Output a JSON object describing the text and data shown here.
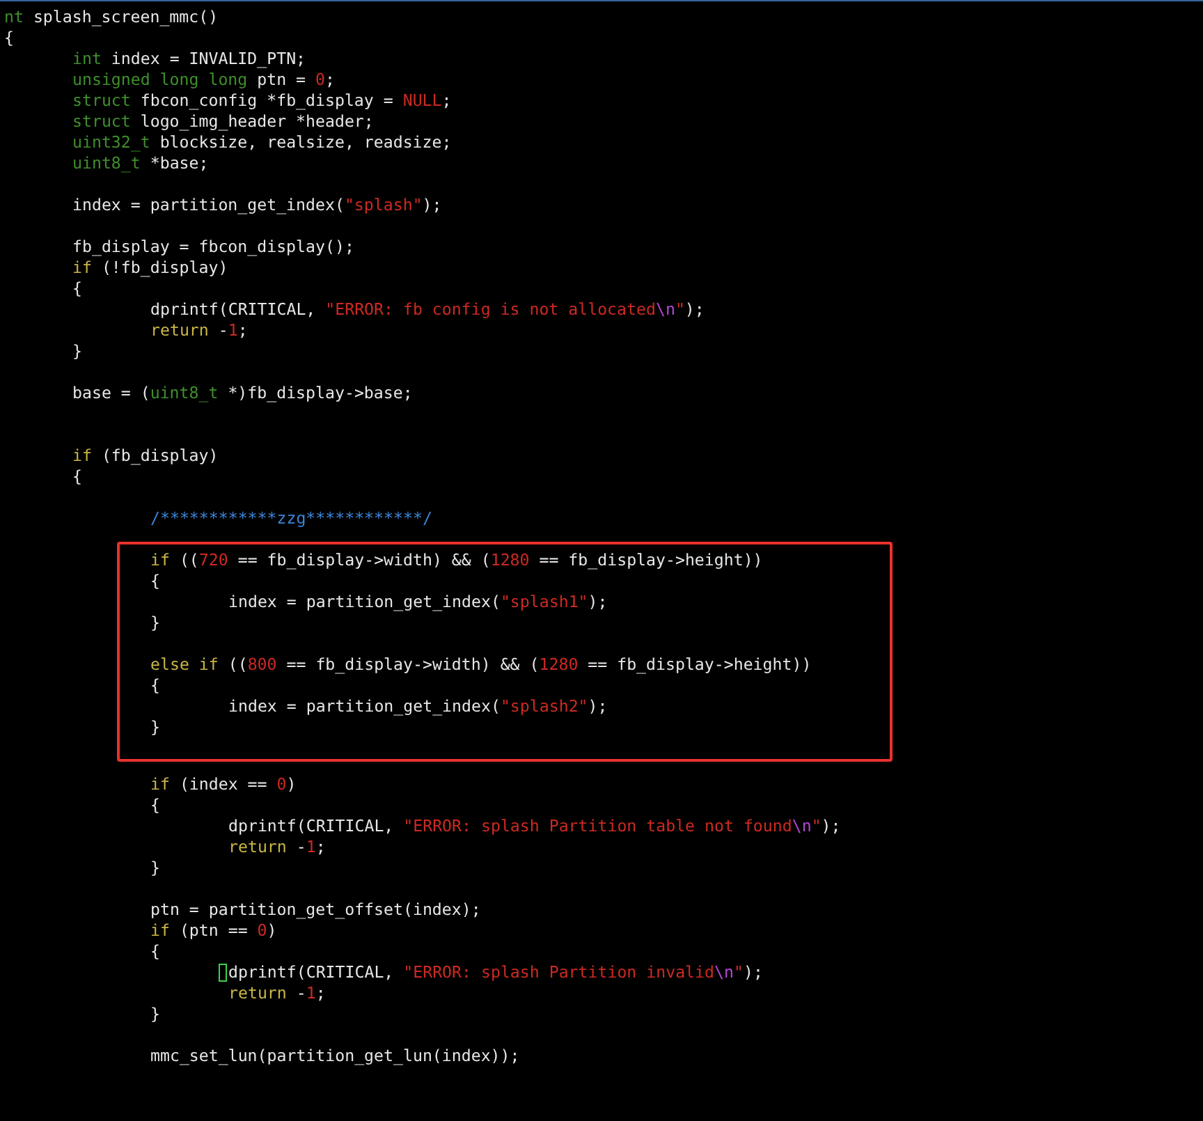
{
  "editor": {
    "lines": [
      {
        "kind": "code",
        "segments": [
          {
            "text": "nt",
            "kind": "type"
          },
          {
            "text": " splash_screen_mmc()",
            "kind": "plain"
          }
        ]
      },
      {
        "kind": "code",
        "segments": [
          {
            "text": "{",
            "kind": "plain"
          }
        ],
        "children": [
          {
            "kind": "code",
            "segments": [
              {
                "text": "int",
                "kind": "type"
              },
              {
                "text": " index = INVALID_PTN;",
                "kind": "plain"
              }
            ]
          },
          {
            "kind": "code",
            "segments": [
              {
                "text": "unsigned long long",
                "kind": "type"
              },
              {
                "text": " ptn = ",
                "kind": "plain"
              },
              {
                "text": "0",
                "kind": "number"
              },
              {
                "text": ";",
                "kind": "plain"
              }
            ]
          },
          {
            "kind": "code",
            "segments": [
              {
                "text": "struct",
                "kind": "type"
              },
              {
                "text": " fbcon_config *fb_display = ",
                "kind": "plain"
              },
              {
                "text": "NULL",
                "kind": "number"
              },
              {
                "text": ";",
                "kind": "plain"
              }
            ]
          },
          {
            "kind": "code",
            "segments": [
              {
                "text": "struct",
                "kind": "type"
              },
              {
                "text": " logo_img_header *header;",
                "kind": "plain"
              }
            ]
          },
          {
            "kind": "code",
            "segments": [
              {
                "text": "uint32_t",
                "kind": "type"
              },
              {
                "text": " blocksize, realsize, readsize;",
                "kind": "plain"
              }
            ]
          },
          {
            "kind": "code",
            "segments": [
              {
                "text": "uint8_t",
                "kind": "type"
              },
              {
                "text": " *base;",
                "kind": "plain"
              }
            ]
          },
          {
            "kind": "blank"
          },
          {
            "kind": "code",
            "segments": [
              {
                "text": "index = partition_get_index(",
                "kind": "plain"
              },
              {
                "text": "\"splash\"",
                "kind": "string"
              },
              {
                "text": ");",
                "kind": "plain"
              }
            ]
          },
          {
            "kind": "blank"
          },
          {
            "kind": "code",
            "segments": [
              {
                "text": "fb_display = fbcon_display();",
                "kind": "plain"
              }
            ]
          },
          {
            "kind": "code",
            "segments": [
              {
                "text": "if",
                "kind": "keyword"
              },
              {
                "text": " (!fb_display)",
                "kind": "plain"
              }
            ]
          },
          {
            "kind": "code",
            "segments": [
              {
                "text": "{",
                "kind": "plain"
              }
            ],
            "children": [
              {
                "kind": "code",
                "segments": [
                  {
                    "text": "dprintf(CRITICAL, ",
                    "kind": "plain"
                  },
                  {
                    "text": "\"ERROR: fb config is not allocated",
                    "kind": "string"
                  },
                  {
                    "text": "\\n",
                    "kind": "escape"
                  },
                  {
                    "text": "\"",
                    "kind": "string"
                  },
                  {
                    "text": ");",
                    "kind": "plain"
                  }
                ]
              },
              {
                "kind": "code",
                "segments": [
                  {
                    "text": "return",
                    "kind": "keyword"
                  },
                  {
                    "text": " -",
                    "kind": "plain"
                  },
                  {
                    "text": "1",
                    "kind": "number"
                  },
                  {
                    "text": ";",
                    "kind": "plain"
                  }
                ]
              }
            ]
          },
          {
            "kind": "code",
            "segments": [
              {
                "text": "}",
                "kind": "plain"
              }
            ]
          },
          {
            "kind": "blank"
          },
          {
            "kind": "code",
            "segments": [
              {
                "text": "base = (",
                "kind": "plain"
              },
              {
                "text": "uint8_t",
                "kind": "type"
              },
              {
                "text": " *)fb_display->base;",
                "kind": "plain"
              }
            ]
          },
          {
            "kind": "blank"
          },
          {
            "kind": "blank"
          },
          {
            "kind": "code",
            "segments": [
              {
                "text": "if",
                "kind": "keyword"
              },
              {
                "text": " (fb_display)",
                "kind": "plain"
              }
            ]
          },
          {
            "kind": "code",
            "segments": [
              {
                "text": "{",
                "kind": "plain"
              }
            ],
            "children": [
              {
                "kind": "blank"
              },
              {
                "kind": "code",
                "segments": [
                  {
                    "text": "/************zzg************/",
                    "kind": "comment"
                  }
                ]
              },
              {
                "kind": "blank"
              },
              {
                "kind": "highlight",
                "children": [
                  {
                    "kind": "code",
                    "segments": [
                      {
                        "text": "if",
                        "kind": "keyword"
                      },
                      {
                        "text": " ((",
                        "kind": "plain"
                      },
                      {
                        "text": "720",
                        "kind": "number"
                      },
                      {
                        "text": " == fb_display->width) && (",
                        "kind": "plain"
                      },
                      {
                        "text": "1280",
                        "kind": "number"
                      },
                      {
                        "text": " == fb_display->height))",
                        "kind": "plain"
                      }
                    ]
                  },
                  {
                    "kind": "code",
                    "segments": [
                      {
                        "text": "{",
                        "kind": "plain"
                      }
                    ],
                    "children": [
                      {
                        "kind": "code",
                        "segments": [
                          {
                            "text": "index = partition_get_index(",
                            "kind": "plain"
                          },
                          {
                            "text": "\"splash1\"",
                            "kind": "string"
                          },
                          {
                            "text": ");",
                            "kind": "plain"
                          }
                        ]
                      }
                    ]
                  },
                  {
                    "kind": "code",
                    "segments": [
                      {
                        "text": "}",
                        "kind": "plain"
                      }
                    ]
                  },
                  {
                    "kind": "blank"
                  },
                  {
                    "kind": "code",
                    "segments": [
                      {
                        "text": "else if",
                        "kind": "keyword"
                      },
                      {
                        "text": " ((",
                        "kind": "plain"
                      },
                      {
                        "text": "800",
                        "kind": "number"
                      },
                      {
                        "text": " == fb_display->width) && (",
                        "kind": "plain"
                      },
                      {
                        "text": "1280",
                        "kind": "number"
                      },
                      {
                        "text": " == fb_display->height))",
                        "kind": "plain"
                      }
                    ]
                  },
                  {
                    "kind": "code",
                    "segments": [
                      {
                        "text": "{",
                        "kind": "plain"
                      }
                    ],
                    "children": [
                      {
                        "kind": "code",
                        "segments": [
                          {
                            "text": "index = partition_get_index(",
                            "kind": "plain"
                          },
                          {
                            "text": "\"splash2\"",
                            "kind": "string"
                          },
                          {
                            "text": ");",
                            "kind": "plain"
                          }
                        ]
                      }
                    ]
                  },
                  {
                    "kind": "code",
                    "segments": [
                      {
                        "text": "}",
                        "kind": "plain"
                      }
                    ]
                  },
                  {
                    "kind": "blank"
                  }
                ]
              },
              {
                "kind": "blank"
              },
              {
                "kind": "code",
                "segments": [
                  {
                    "text": "if",
                    "kind": "keyword"
                  },
                  {
                    "text": " (index == ",
                    "kind": "plain"
                  },
                  {
                    "text": "0",
                    "kind": "number"
                  },
                  {
                    "text": ")",
                    "kind": "plain"
                  }
                ]
              },
              {
                "kind": "code",
                "segments": [
                  {
                    "text": "{",
                    "kind": "plain"
                  }
                ],
                "children": [
                  {
                    "kind": "code",
                    "segments": [
                      {
                        "text": "dprintf(CRITICAL, ",
                        "kind": "plain"
                      },
                      {
                        "text": "\"ERROR: splash Partition table not found",
                        "kind": "string"
                      },
                      {
                        "text": "\\n",
                        "kind": "escape"
                      },
                      {
                        "text": "\"",
                        "kind": "string"
                      },
                      {
                        "text": ");",
                        "kind": "plain"
                      }
                    ]
                  },
                  {
                    "kind": "code",
                    "segments": [
                      {
                        "text": "return",
                        "kind": "keyword"
                      },
                      {
                        "text": " -",
                        "kind": "plain"
                      },
                      {
                        "text": "1",
                        "kind": "number"
                      },
                      {
                        "text": ";",
                        "kind": "plain"
                      }
                    ]
                  }
                ]
              },
              {
                "kind": "code",
                "segments": [
                  {
                    "text": "}",
                    "kind": "plain"
                  }
                ]
              },
              {
                "kind": "blank"
              },
              {
                "kind": "code",
                "segments": [
                  {
                    "text": "ptn = partition_get_offset(index);",
                    "kind": "plain"
                  }
                ]
              },
              {
                "kind": "code",
                "segments": [
                  {
                    "text": "if",
                    "kind": "keyword"
                  },
                  {
                    "text": " (ptn == ",
                    "kind": "plain"
                  },
                  {
                    "text": "0",
                    "kind": "number"
                  },
                  {
                    "text": ")",
                    "kind": "plain"
                  }
                ]
              },
              {
                "kind": "code",
                "segments": [
                  {
                    "text": "{",
                    "kind": "plain"
                  }
                ],
                "children": [
                  {
                    "kind": "code",
                    "segments": [
                      {
                        "kind": "cursor"
                      },
                      {
                        "text": "dprintf(CRITICAL, ",
                        "kind": "plain"
                      },
                      {
                        "text": "\"ERROR: splash Partition invalid",
                        "kind": "string"
                      },
                      {
                        "text": "\\n",
                        "kind": "escape"
                      },
                      {
                        "text": "\"",
                        "kind": "string"
                      },
                      {
                        "text": ");",
                        "kind": "plain"
                      }
                    ]
                  },
                  {
                    "kind": "code",
                    "segments": [
                      {
                        "text": "return",
                        "kind": "keyword"
                      },
                      {
                        "text": " -",
                        "kind": "plain"
                      },
                      {
                        "text": "1",
                        "kind": "number"
                      },
                      {
                        "text": ";",
                        "kind": "plain"
                      }
                    ]
                  }
                ]
              },
              {
                "kind": "code",
                "segments": [
                  {
                    "text": "}",
                    "kind": "plain"
                  }
                ]
              },
              {
                "kind": "blank"
              },
              {
                "kind": "code",
                "segments": [
                  {
                    "text": "mmc_set_lun(partition_get_lun(index));",
                    "kind": "plain"
                  }
                ]
              }
            ]
          }
        ]
      }
    ]
  }
}
